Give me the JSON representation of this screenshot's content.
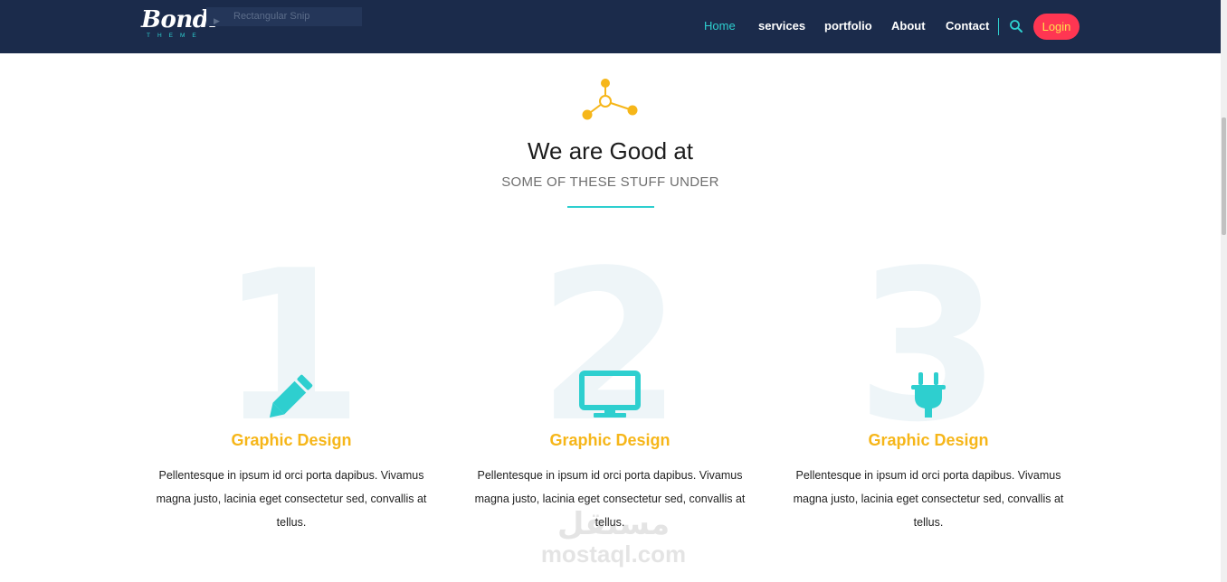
{
  "header": {
    "logo_script": "Bondi",
    "logo_sub": "THEME",
    "tooltip": "Rectangular Snip",
    "nav": [
      {
        "label": "Home"
      },
      {
        "label": "services"
      },
      {
        "label": "portfolio"
      },
      {
        "label": "About"
      },
      {
        "label": "Contact"
      }
    ],
    "login_label": "Login"
  },
  "section": {
    "title": "We are Good at",
    "subtitle": "SOME OF THESE STUFF UNDER"
  },
  "services": [
    {
      "number": "1",
      "icon": "pencil-icon",
      "title": "Graphic Design",
      "description": "Pellentesque in ipsum id orci porta dapibus. Vivamus magna justo, lacinia eget consectetur sed, convallis at tellus."
    },
    {
      "number": "2",
      "icon": "monitor-icon",
      "title": "Graphic Design",
      "description": "Pellentesque in ipsum id orci porta dapibus. Vivamus magna justo, lacinia eget consectetur sed, convallis at tellus."
    },
    {
      "number": "3",
      "icon": "plug-icon",
      "title": "Graphic Design",
      "description": "Pellentesque in ipsum id orci porta dapibus. Vivamus magna justo, lacinia eget consectetur sed, convallis at tellus."
    }
  ],
  "watermark": {
    "arabic": "مستقل",
    "latin": "mostaql.com"
  },
  "colors": {
    "navbar": "#1b2b4b",
    "accent": "#2ecfcf",
    "title": "#f6b619",
    "login": "#ff3652"
  }
}
